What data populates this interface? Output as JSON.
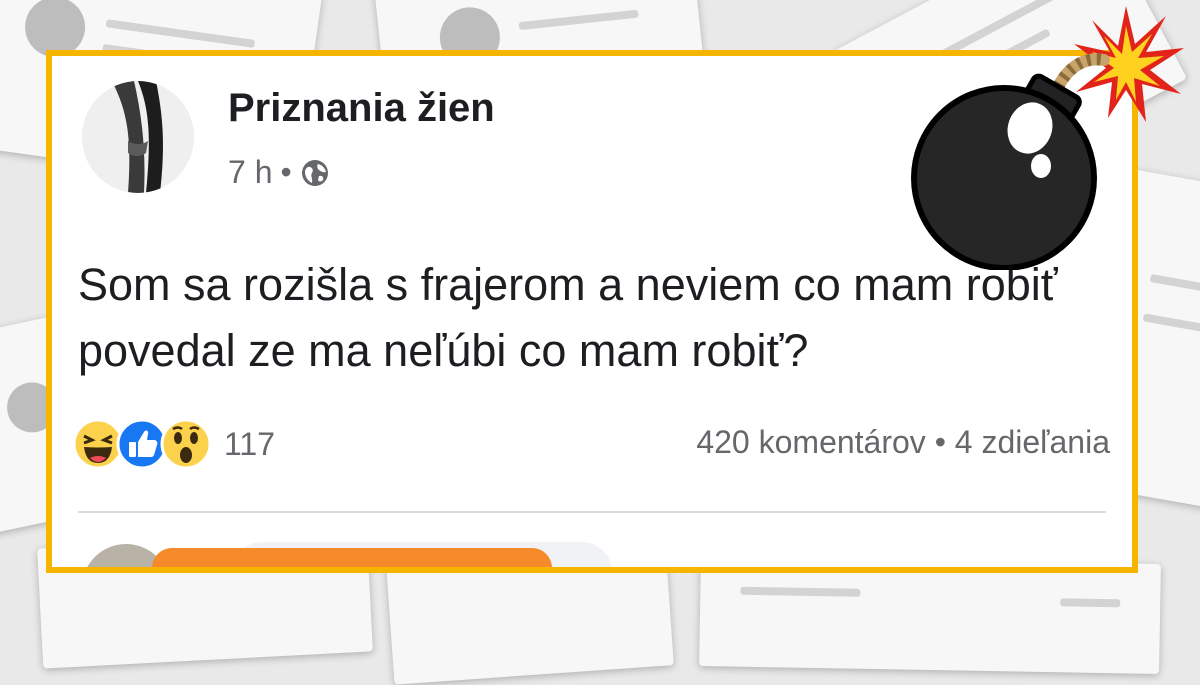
{
  "post": {
    "author": "Priznania žien",
    "time": "7 h",
    "separator": "•",
    "privacy_icon": "globe-icon",
    "text": "Som sa rozišla s frajerom a neviem co mam robiť povedal ze ma neľúbi co mam robiť?",
    "reactions": [
      "haha-icon",
      "like-icon",
      "wow-icon"
    ],
    "reaction_count": "117",
    "stats": "420 komentárov • 4 zdieľania"
  },
  "decoration": {
    "frame_color": "#f7b500",
    "bomb_icon": "bomb-icon"
  }
}
